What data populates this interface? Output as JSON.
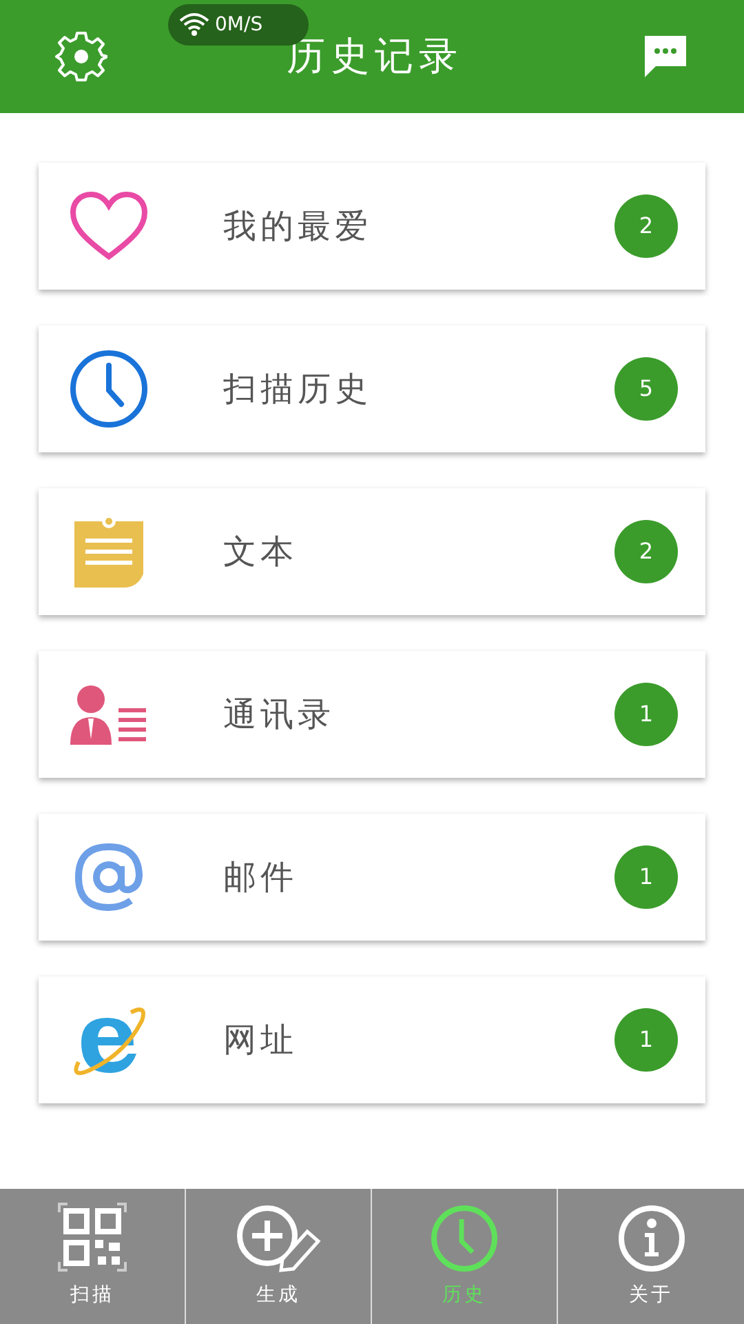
{
  "status_pill": {
    "speed": "0M/S"
  },
  "header": {
    "title": "历史记录"
  },
  "items": [
    {
      "kind": "heart",
      "label": "我的最爱",
      "count": "2"
    },
    {
      "kind": "clock",
      "label": "扫描历史",
      "count": "5"
    },
    {
      "kind": "note",
      "label": "文本",
      "count": "2"
    },
    {
      "kind": "contact",
      "label": "通讯录",
      "count": "1"
    },
    {
      "kind": "at",
      "label": "邮件",
      "count": "1"
    },
    {
      "kind": "web",
      "label": "网址",
      "count": "1"
    }
  ],
  "tabs": [
    {
      "kind": "qr",
      "label": "扫描",
      "selected": false
    },
    {
      "kind": "create",
      "label": "生成",
      "selected": false
    },
    {
      "kind": "clock",
      "label": "历史",
      "selected": true
    },
    {
      "kind": "info",
      "label": "关于",
      "selected": false
    }
  ]
}
